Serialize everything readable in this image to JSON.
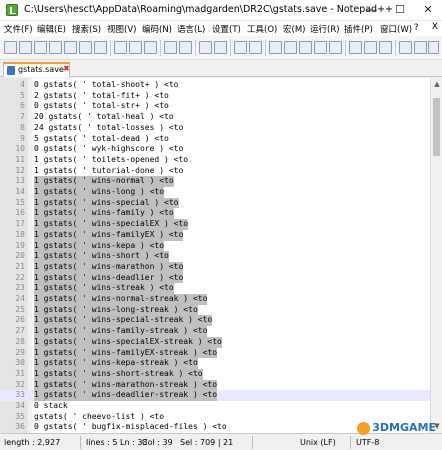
{
  "window": {
    "title": "C:\\Users\\hesct\\AppData\\Roaming\\madgarden\\DR2C\\gstats.save - Notepad++",
    "minimize": "—",
    "maximize": "☐",
    "close": "✕"
  },
  "menu": [
    "文件(F)",
    "编辑(E)",
    "搜索(S)",
    "视图(V)",
    "编码(N)",
    "语言(L)",
    "设置(T)",
    "工具(O)",
    "宏(M)",
    "运行(R)",
    "插件(P)",
    "窗口(W)",
    "?"
  ],
  "menu_close": "X",
  "toolbar_icons": [
    "new-file",
    "open-file",
    "save",
    "save-all",
    "close",
    "close-all",
    "print",
    "cut",
    "copy",
    "paste",
    "undo",
    "redo",
    "find",
    "replace",
    "zoom-in",
    "zoom-out",
    "sync-v",
    "sync-h",
    "word-wrap",
    "show-all",
    "indent-guide",
    "doc-map",
    "function-list",
    "folder-workspace",
    "record-macro",
    "stop-macro",
    "play-macro",
    "run-macro",
    "save-macro"
  ],
  "tab": {
    "label": "gstats.save",
    "close": "✖"
  },
  "lines": [
    {
      "n": "4",
      "t": "0 gstats( ' total-shoot+ ) <to"
    },
    {
      "n": "5",
      "t": "2 gstats( ' total-fit+ ) <to"
    },
    {
      "n": "6",
      "t": "0 gstats( ' total-str+ ) <to"
    },
    {
      "n": "7",
      "t": "20 gstats( ' total-heal ) <to"
    },
    {
      "n": "8",
      "t": "24 gstats( ' total-losses ) <to"
    },
    {
      "n": "9",
      "t": "5 gstats( ' total-dead ) <to"
    },
    {
      "n": "10",
      "t": "0 gstats( ' wyk-highscore ) <to"
    },
    {
      "n": "11",
      "t": "1 gstats( ' toilets-opened ) <to"
    },
    {
      "n": "12",
      "t": "1 gstats( ' tutorial-done ) <to"
    },
    {
      "n": "13",
      "t": "1 gstats( ' wins-normal ) <to",
      "s": true
    },
    {
      "n": "14",
      "t": "1 gstats( ' wins-long ) <to",
      "s": true
    },
    {
      "n": "15",
      "t": "1 gstats( ' wins-special ) <to",
      "s": true
    },
    {
      "n": "16",
      "t": "1 gstats( ' wins-family ) <to",
      "s": true
    },
    {
      "n": "17",
      "t": "1 gstats( ' wins-specialEX ) <to",
      "s": true
    },
    {
      "n": "18",
      "t": "1 gstats( ' wins-familyEX ) <to",
      "s": true
    },
    {
      "n": "19",
      "t": "1 gstats( ' wins-kepa ) <to",
      "s": true
    },
    {
      "n": "20",
      "t": "1 gstats( ' wins-short ) <to",
      "s": true
    },
    {
      "n": "21",
      "t": "1 gstats( ' wins-marathon ) <to",
      "s": true
    },
    {
      "n": "22",
      "t": "1 gstats( ' wins-deadlier ) <to",
      "s": true
    },
    {
      "n": "23",
      "t": "1 gstats( ' wins-streak ) <to",
      "s": true
    },
    {
      "n": "24",
      "t": "1 gstats( ' wins-normal-streak ) <to",
      "s": true
    },
    {
      "n": "25",
      "t": "1 gstats( ' wins-long-streak ) <to",
      "s": true
    },
    {
      "n": "26",
      "t": "1 gstats( ' wins-special-streak ) <to",
      "s": true
    },
    {
      "n": "27",
      "t": "1 gstats( ' wins-family-streak ) <to",
      "s": true
    },
    {
      "n": "28",
      "t": "1 gstats( ' wins-specialEX-streak ) <to",
      "s": true
    },
    {
      "n": "29",
      "t": "1 gstats( ' wins-familyEX-streak ) <to",
      "s": true
    },
    {
      "n": "30",
      "t": "1 gstats( ' wins-kepa-streak ) <to",
      "s": true
    },
    {
      "n": "31",
      "t": "1 gstats( ' wins-short-streak ) <to",
      "s": true
    },
    {
      "n": "32",
      "t": "1 gstats( ' wins-marathon-streak ) <to",
      "s": true
    },
    {
      "n": "33",
      "t": "1 gstats( ' wins-deadlier-streak ) <to",
      "s": true,
      "c": true
    },
    {
      "n": "34",
      "t": "0 stack"
    },
    {
      "n": "35",
      "t": "gstats( ' cheevo-list ) <to"
    },
    {
      "n": "36",
      "t": "0 gstats( ' bugfix-misplaced-files ) <to"
    },
    {
      "n": "37",
      "t": "0 gstats( ' oldstats-transfer ) <to"
    }
  ],
  "status": {
    "length": "length : 2,927",
    "lines": "lines : 5 Ln : 33",
    "col": "Col : 39",
    "sel": "Sel : 709 | 21",
    "eol": "Unix (LF)",
    "enc": "UTF-8",
    "mode": "INS"
  },
  "watermark": "3DMGAME"
}
